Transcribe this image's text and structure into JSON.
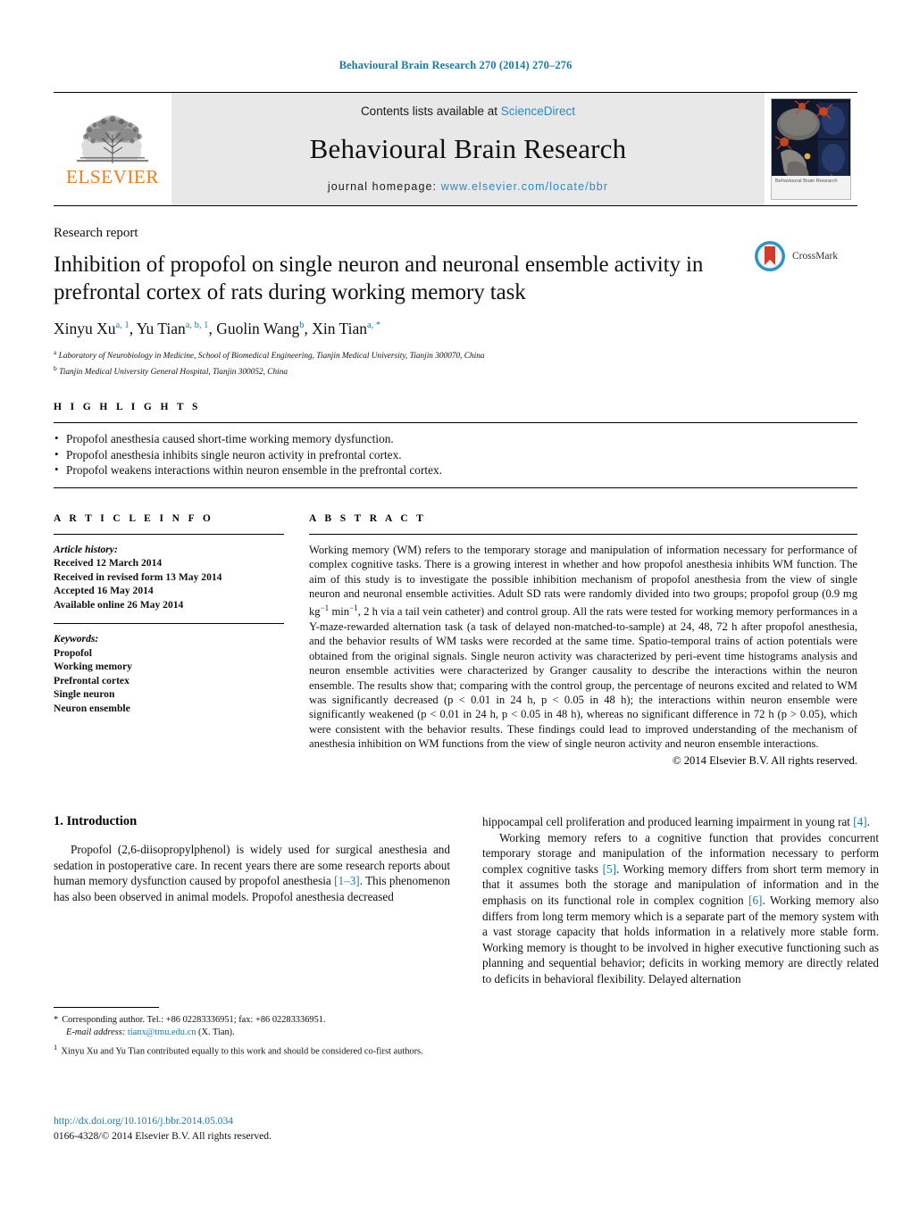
{
  "running_head": "Behavioural Brain Research 270 (2014) 270–276",
  "masthead": {
    "publisher": "ELSEVIER",
    "contents_prefix": "Contents lists available at ",
    "contents_link": "ScienceDirect",
    "journal_title": "Behavioural Brain Research",
    "homepage_prefix": "journal homepage:",
    "homepage_url": "www.elsevier.com/locate/bbr",
    "cover_caption": "Behavioural Brain Research"
  },
  "article": {
    "type": "Research report",
    "title": "Inhibition of propofol on single neuron and neuronal ensemble activity in prefrontal cortex of rats during working memory task",
    "authors": [
      {
        "name": "Xinyu Xu",
        "sup": "a, 1"
      },
      {
        "name": "Yu Tian",
        "sup": "a, b, 1"
      },
      {
        "name": "Guolin Wang",
        "sup": "b"
      },
      {
        "name": "Xin Tian",
        "sup": "a, *"
      }
    ],
    "affiliations": [
      {
        "marker": "a",
        "text": "Laboratory of Neurobiology in Medicine, School of Biomedical Engineering, Tianjin Medical University, Tianjin 300070, China"
      },
      {
        "marker": "b",
        "text": "Tianjin Medical University General Hospital, Tianjin 300052, China"
      }
    ],
    "crossmark_label": "CrossMark"
  },
  "highlights": {
    "label": "H I G H L I G H T S",
    "items": [
      "Propofol anesthesia caused short-time working memory dysfunction.",
      "Propofol anesthesia inhibits single neuron activity in prefrontal cortex.",
      "Propofol weakens interactions within neuron ensemble in the prefrontal cortex."
    ]
  },
  "article_info": {
    "label": "A R T I C L E    I N F O",
    "history_heading": "Article history:",
    "history": [
      "Received 12 March 2014",
      "Received in revised form 13 May 2014",
      "Accepted 16 May 2014",
      "Available online 26 May 2014"
    ],
    "keywords_heading": "Keywords:",
    "keywords": [
      "Propofol",
      "Working memory",
      "Prefrontal cortex",
      "Single neuron",
      "Neuron ensemble"
    ]
  },
  "abstract": {
    "label": "A B S T R A C T",
    "text_part1": "Working memory (WM) refers to the temporary storage and manipulation of information necessary for performance of complex cognitive tasks. There is a growing interest in whether and how propofol anesthesia inhibits WM function. The aim of this study is to investigate the possible inhibition mechanism of propofol anesthesia from the view of single neuron and neuronal ensemble activities. Adult SD rats were randomly divided into two groups; propofol group (0.9 mg kg",
    "sup1": "−1",
    "text_part2": " min",
    "sup2": "−1",
    "text_part3": ", 2 h via a tail vein catheter) and control group. All the rats were tested for working memory performances in a Y-maze-rewarded alternation task (a task of delayed non-matched-to-sample) at 24, 48, 72 h after propofol anesthesia, and the behavior results of WM tasks were recorded at the same time. Spatio-temporal trains of action potentials were obtained from the original signals. Single neuron activity was characterized by peri-event time histograms analysis and neuron ensemble activities were characterized by Granger causality to describe the interactions within the neuron ensemble. The results show that; comparing with the control group, the percentage of neurons excited and related to WM was significantly decreased (p < 0.01 in 24 h, p < 0.05 in 48 h); the interactions within neuron ensemble were significantly weakened (p < 0.01 in 24 h, p < 0.05 in 48 h), whereas no significant difference in 72 h (p > 0.05), which were consistent with the behavior results. These findings could lead to improved understanding of the mechanism of anesthesia inhibition on WM functions from the view of single neuron activity and neuron ensemble interactions.",
    "copyright": "© 2014 Elsevier B.V. All rights reserved."
  },
  "introduction": {
    "heading": "1.  Introduction",
    "left_para1_a": "Propofol (2,6-diisopropylphenol) is widely used for surgical anesthesia and sedation in postoperative care. In recent years there are some research reports about human memory dysfunction caused by propofol anesthesia ",
    "left_para1_ref": "[1–3]",
    "left_para1_b": ". This phenomenon has also been observed in animal models. Propofol anesthesia decreased",
    "right_para1_a": "hippocampal cell proliferation and produced learning impairment in young rat ",
    "right_para1_ref": "[4]",
    "right_para1_b": ".",
    "right_para2_a": "Working memory refers to a cognitive function that provides concurrent temporary storage and manipulation of the information necessary to perform complex cognitive tasks ",
    "right_para2_ref1": "[5]",
    "right_para2_b": ". Working memory differs from short term memory in that it assumes both the storage and manipulation of information and in the emphasis on its functional role in complex cognition ",
    "right_para2_ref2": "[6]",
    "right_para2_c": ". Working memory also differs from long term memory which is a separate part of the memory system with a vast storage capacity that holds information in a relatively more stable form. Working memory is thought to be involved in higher executive functioning such as planning and sequential behavior; deficits in working memory are directly related to deficits in behavioral flexibility. Delayed alternation"
  },
  "footnotes": {
    "corresponding_marker": "*",
    "corresponding_text": "Corresponding author. Tel.: +86 02283336951; fax: +86 02283336951.",
    "email_label": "E-mail address:",
    "email": "tianx@tmu.edu.cn",
    "email_suffix": " (X. Tian).",
    "equal_marker": "1",
    "equal_text": "Xinyu Xu and Yu Tian contributed equally to this work and should be considered co-first authors.",
    "doi": "http://dx.doi.org/10.1016/j.bbr.2014.05.034",
    "issn": "0166-4328/© 2014 Elsevier B.V. All rights reserved."
  },
  "colors": {
    "link_blue": "#1a7aa8",
    "science_direct_blue": "#2b88c8",
    "elsevier_orange": "#f07c1a"
  }
}
